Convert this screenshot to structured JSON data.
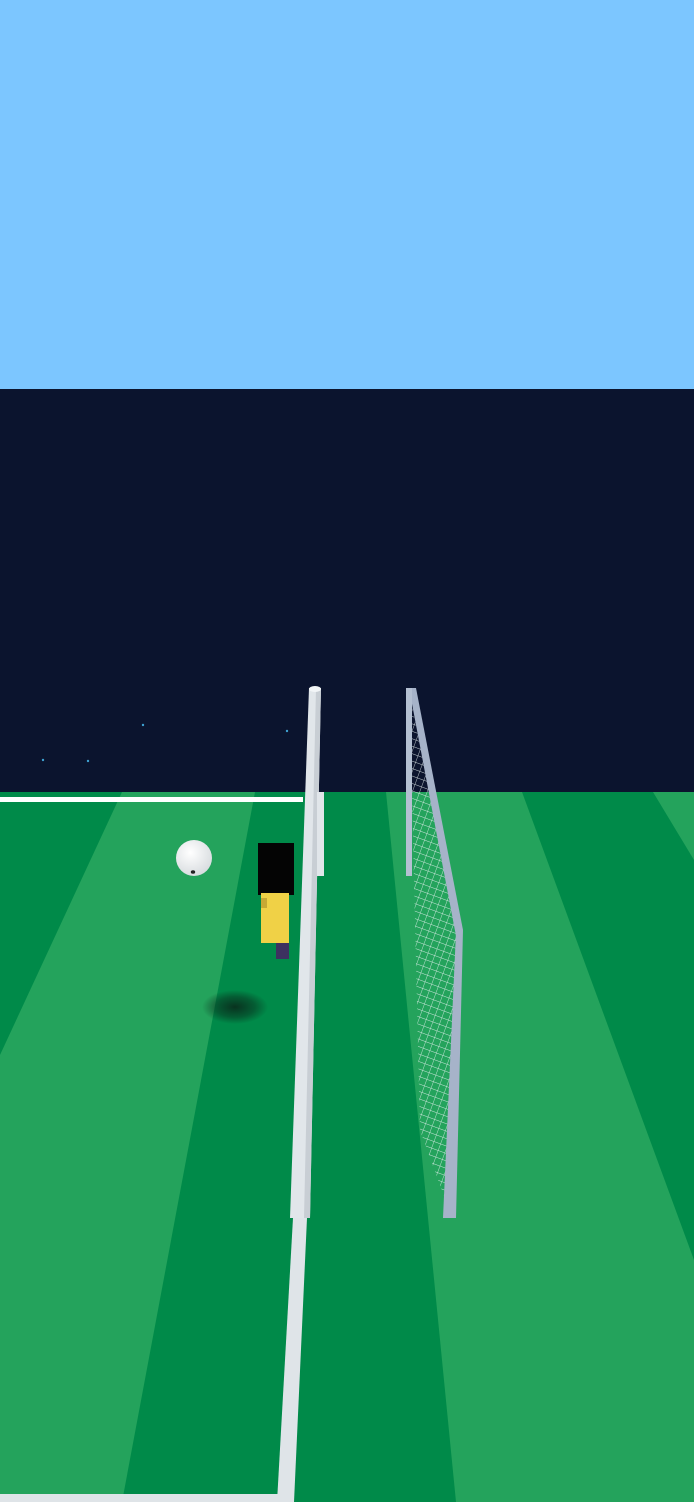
{
  "scene": {
    "colors": {
      "sky": "#7cc6ff",
      "stands": "#0b142e",
      "pitch_dark": "#008a49",
      "pitch_light": "#24a35c",
      "line": "#ffffff",
      "goal_post": "#e1e6ea",
      "goal_frame": "#a6b3c9",
      "net": "#e8f2f2",
      "ball": "#f2f2f2",
      "player_hair": "#040404",
      "player_shirt": "#f0d146",
      "player_shorts": "#3d3160",
      "shadow": "#0a2318",
      "spark": "#3ea0d0"
    },
    "objects": {
      "ball": "soccer-ball",
      "player": "goalkeeper-figure",
      "goal": "soccer-goal"
    }
  }
}
